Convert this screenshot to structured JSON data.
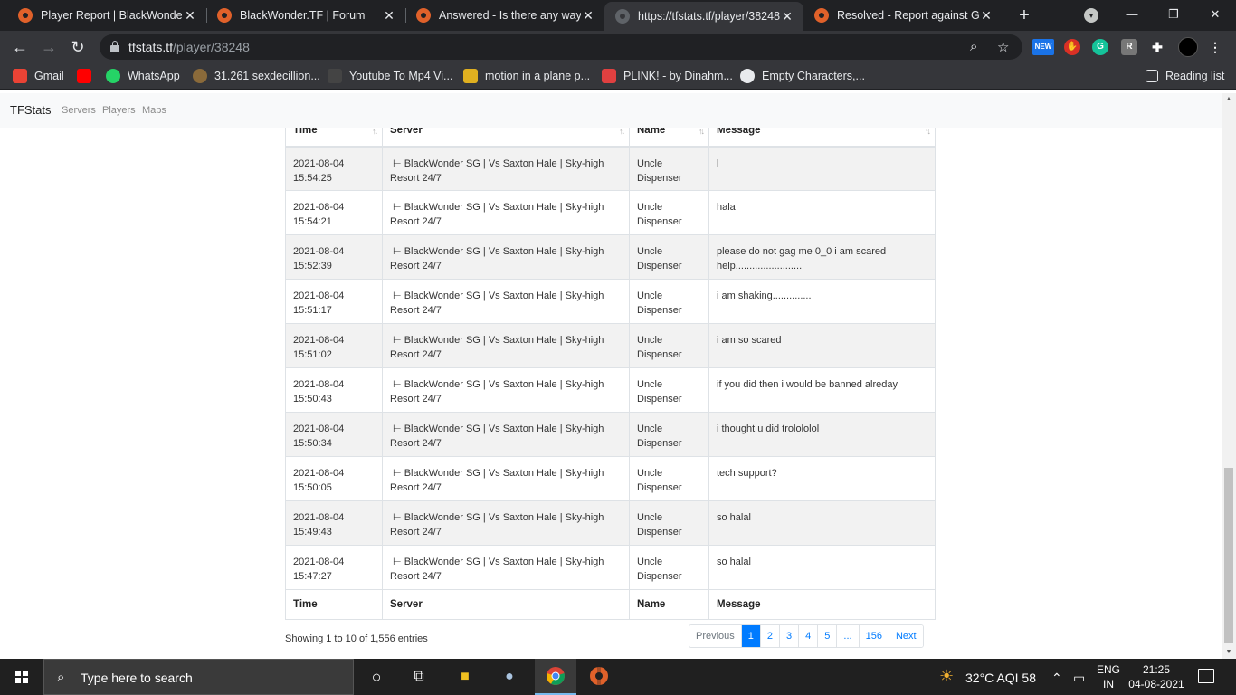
{
  "browser": {
    "tabs": [
      {
        "title": "Player Report | BlackWonder.TF",
        "active": false
      },
      {
        "title": "BlackWonder.TF | Forum",
        "active": false
      },
      {
        "title": "Answered - Is there any way I",
        "active": false
      },
      {
        "title": "https://tfstats.tf/player/38248",
        "active": true
      },
      {
        "title": "Resolved - Report against GA",
        "active": false
      }
    ],
    "tab_close": "✕",
    "new_tab": "+",
    "url_host": "tfstats.tf",
    "url_path": "/player/38248",
    "ext_new_label": "NEW"
  },
  "bookmarks": [
    {
      "label": "Gmail",
      "color": "#ea4335"
    },
    {
      "label": "",
      "color": "#ff0000"
    },
    {
      "label": "WhatsApp",
      "color": "#25d366"
    },
    {
      "label": "31.261 sexdecillion...",
      "color": "#8a6a3a"
    },
    {
      "label": "Youtube To Mp4 Vi...",
      "color": "#444444"
    },
    {
      "label": "motion in a plane p...",
      "color": "#e0b020"
    },
    {
      "label": "PLINK! - by Dinahm...",
      "color": "#e04040"
    },
    {
      "label": "Empty Characters,...",
      "color": "#e8eaed"
    }
  ],
  "reading_list": "Reading list",
  "site": {
    "brand": "TFStats",
    "nav": [
      "Servers",
      "Players",
      "Maps"
    ]
  },
  "table": {
    "headers": [
      "Time",
      "Server",
      "Name",
      "Message"
    ],
    "rows": [
      {
        "date": "2021-08-04",
        "time": "15:54:25",
        "server1": "󠀠 ⊢ BlackWonder SG | Vs Saxton Hale | Sky-high",
        "server2": "Resort 24/7",
        "name1": "Uncle",
        "name2": "Dispenser",
        "message": "l"
      },
      {
        "date": "2021-08-04",
        "time": "15:54:21",
        "server1": "󠀠 ⊢ BlackWonder SG | Vs Saxton Hale | Sky-high",
        "server2": "Resort 24/7",
        "name1": "Uncle",
        "name2": "Dispenser",
        "message": "hala"
      },
      {
        "date": "2021-08-04",
        "time": "15:52:39",
        "server1": "󠀠 ⊢ BlackWonder SG | Vs Saxton Hale | Sky-high",
        "server2": "Resort 24/7",
        "name1": "Uncle",
        "name2": "Dispenser",
        "message": "please do not gag me 0_0 i am scared help........................"
      },
      {
        "date": "2021-08-04",
        "time": "15:51:17",
        "server1": "󠀠 ⊢ BlackWonder SG | Vs Saxton Hale | Sky-high",
        "server2": "Resort 24/7",
        "name1": "Uncle",
        "name2": "Dispenser",
        "message": "i am shaking.............."
      },
      {
        "date": "2021-08-04",
        "time": "15:51:02",
        "server1": "󠀠 ⊢ BlackWonder SG | Vs Saxton Hale | Sky-high",
        "server2": "Resort 24/7",
        "name1": "Uncle",
        "name2": "Dispenser",
        "message": "i am so scared"
      },
      {
        "date": "2021-08-04",
        "time": "15:50:43",
        "server1": "󠀠 ⊢ BlackWonder SG | Vs Saxton Hale | Sky-high",
        "server2": "Resort 24/7",
        "name1": "Uncle",
        "name2": "Dispenser",
        "message": "if you did then i would be banned alreday"
      },
      {
        "date": "2021-08-04",
        "time": "15:50:34",
        "server1": "󠀠 ⊢ BlackWonder SG | Vs Saxton Hale | Sky-high",
        "server2": "Resort 24/7",
        "name1": "Uncle",
        "name2": "Dispenser",
        "message": "i thought u did trolololol"
      },
      {
        "date": "2021-08-04",
        "time": "15:50:05",
        "server1": "󠀠 ⊢ BlackWonder SG | Vs Saxton Hale | Sky-high",
        "server2": "Resort 24/7",
        "name1": "Uncle",
        "name2": "Dispenser",
        "message": "tech support?"
      },
      {
        "date": "2021-08-04",
        "time": "15:49:43",
        "server1": "󠀠 ⊢ BlackWonder SG | Vs Saxton Hale | Sky-high",
        "server2": "Resort 24/7",
        "name1": "Uncle",
        "name2": "Dispenser",
        "message": "so halal"
      },
      {
        "date": "2021-08-04",
        "time": "15:47:27",
        "server1": "󠀠 ⊢ BlackWonder SG | Vs Saxton Hale | Sky-high",
        "server2": "Resort 24/7",
        "name1": "Uncle",
        "name2": "Dispenser",
        "message": "so halal"
      }
    ],
    "info": "Showing 1 to 10 of 1,556 entries",
    "pagination": [
      "Previous",
      "1",
      "2",
      "3",
      "4",
      "5",
      "...",
      "156",
      "Next"
    ],
    "active_page": "1"
  },
  "taskbar": {
    "search_placeholder": "Type here to search",
    "weather": "32°C  AQI 58",
    "lang1": "ENG",
    "lang2": "IN",
    "time": "21:25",
    "date": "04-08-2021"
  },
  "colors": {
    "accent": "#007bff",
    "tf2_orange": "#e0612a"
  }
}
